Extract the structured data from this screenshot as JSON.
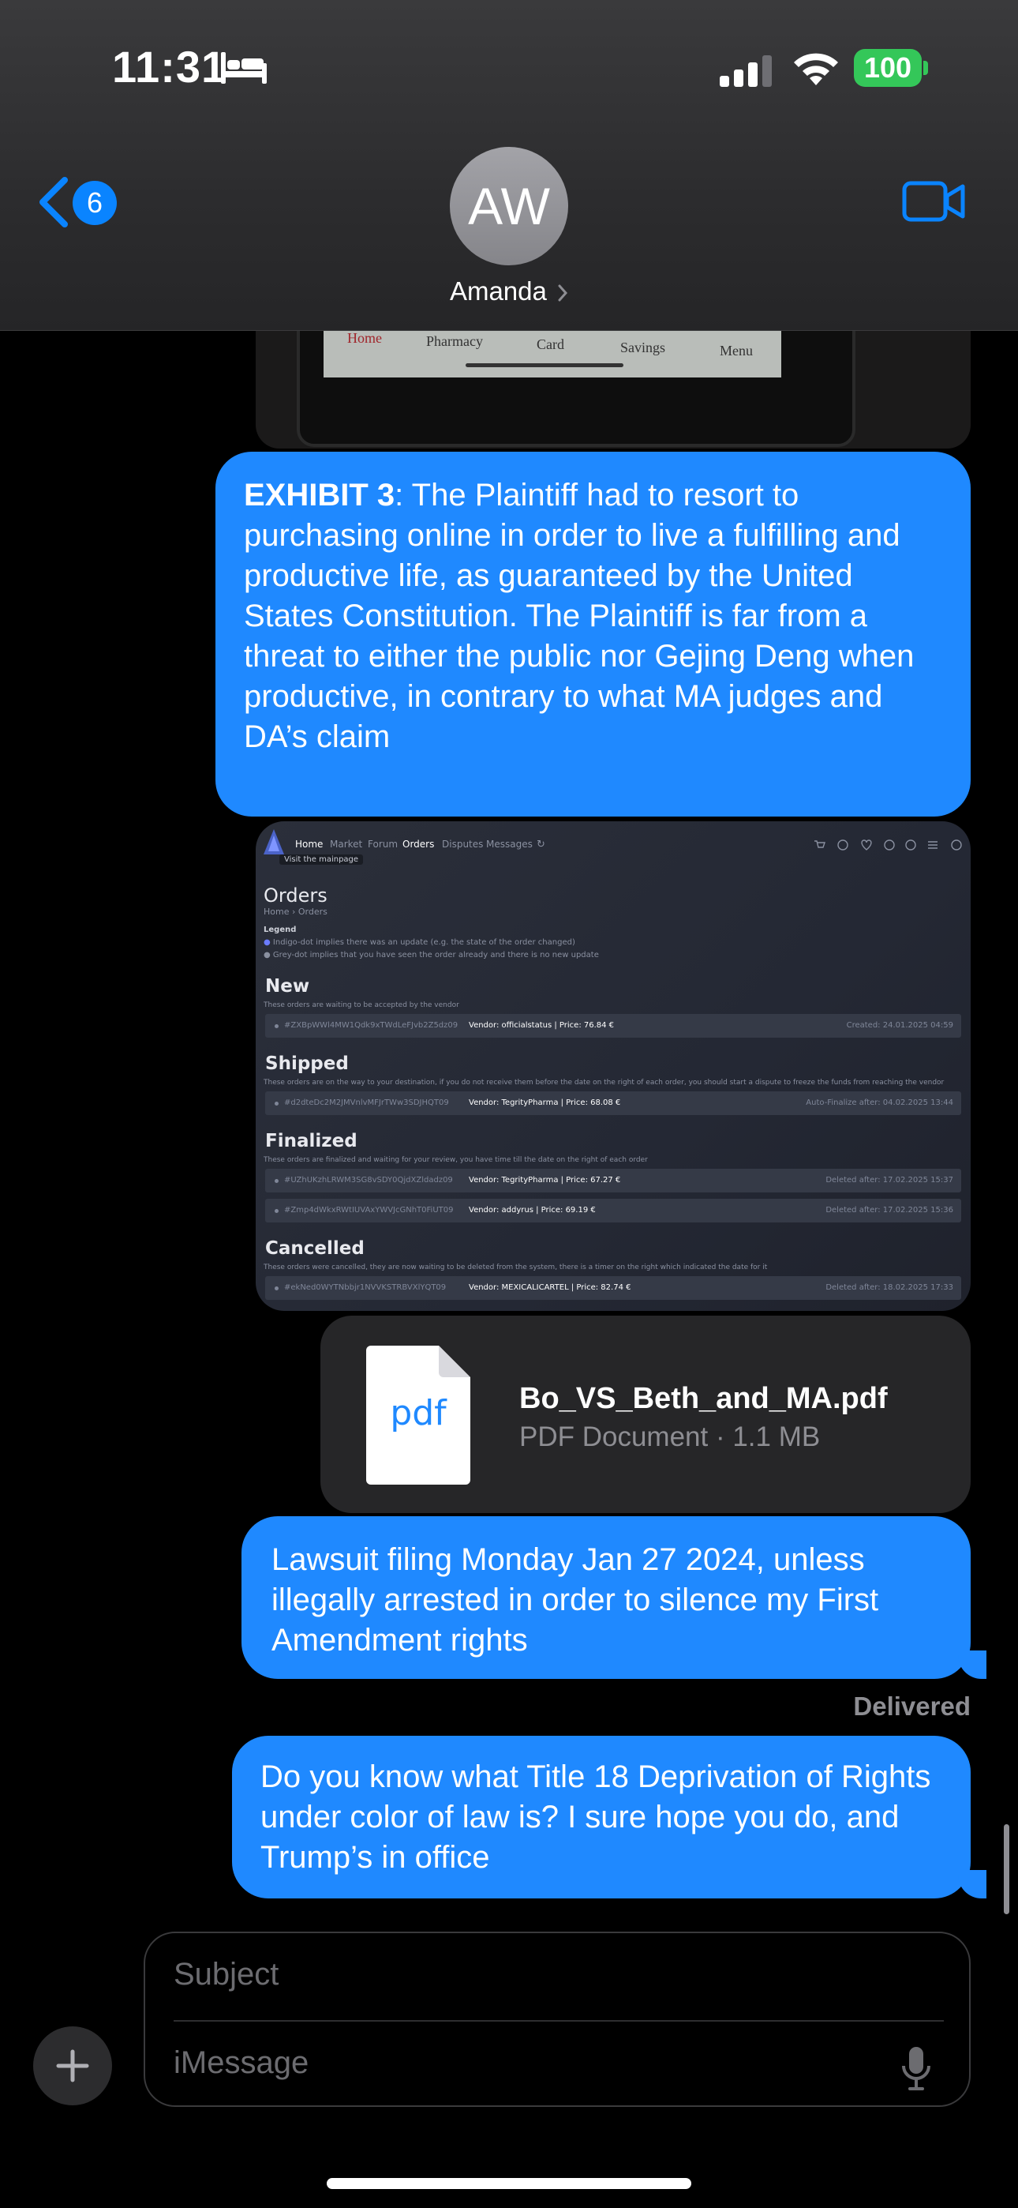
{
  "status_bar": {
    "time": "11:31",
    "battery": "100",
    "icons": [
      "bed-icon",
      "signal-icon",
      "wifi-icon",
      "battery-icon"
    ]
  },
  "header": {
    "back_badge": "6",
    "avatar_initials": "AW",
    "contact_name": "Amanda",
    "icons": [
      "chevron-left-icon",
      "video-call-icon",
      "chevron-right-icon"
    ]
  },
  "photo_preview": {
    "tabs": [
      "Home",
      "Pharmacy",
      "Card",
      "Savings",
      "Menu"
    ]
  },
  "messages": {
    "exhibit": {
      "bold": "EXHIBIT 3",
      "text": ": The Plaintiff had to resort to purchasing online in order to live a fulfilling and productive life, as guaranteed by the United States Constitution. The Plaintiff is far from a threat to either the public nor Gejing Deng when productive, in contrary to what MA judges and DA’s claim"
    },
    "lawsuit": "Lawsuit filing Monday Jan 27 2024, unless illegally arrested in order to silence my First Amendment rights",
    "delivered": "Delivered",
    "title18": "Do you know what Title 18 Deprivation of Rights under color of law is? I sure hope you do, and Trump’s in office"
  },
  "orders_screenshot": {
    "nav": [
      "Home",
      "Market",
      "Forum",
      "Orders",
      "Disputes",
      "Messages"
    ],
    "tooltip": "Visit the mainpage",
    "title": "Orders",
    "breadcrumb": "Home  ›  Orders",
    "legend_title": "Legend",
    "legend_1": "Indigo-dot implies there was an update (e.g. the state of the order changed)",
    "legend_2": "Grey-dot implies that you have seen the order already and there is no new update",
    "sections": [
      {
        "heading": "New",
        "desc": "These orders are waiting to be accepted by the vendor",
        "rows": [
          {
            "id": "#ZXBpWWl4MW1Qdk9xTWdLeFJvb2Z5dz09",
            "vendor": "Vendor: officialstatus | Price: 76.84 €",
            "right": "Created: 24.01.2025 04:59"
          }
        ]
      },
      {
        "heading": "Shipped",
        "desc": "These orders are on the way to your destination, if you do not receive them before the date on the right of each order, you should start a dispute to freeze the funds from reaching the vendor",
        "rows": [
          {
            "id": "#d2dteDc2M2JMVnlvMFJrTWw3SDJHQT09",
            "vendor": "Vendor: TegrityPharma | Price: 68.08 €",
            "right": "Auto-Finalize after: 04.02.2025 13:44"
          }
        ]
      },
      {
        "heading": "Finalized",
        "desc": "These orders are finalized and waiting for your review, you have time till the date on the right of each order",
        "rows": [
          {
            "id": "#UZhUKzhLRWM3SG8vSDY0QjdXZldadz09",
            "vendor": "Vendor: TegrityPharma | Price: 67.27 €",
            "right": "Deleted after: 17.02.2025 15:37"
          },
          {
            "id": "#Zmp4dWkxRWtIUVAxYWVJcGNhT0FiUT09",
            "vendor": "Vendor: addyrus | Price: 69.19 €",
            "right": "Deleted after: 17.02.2025 15:36"
          }
        ]
      },
      {
        "heading": "Cancelled",
        "desc": "These orders were cancelled, they are now waiting to be deleted from the system, there is a timer on the right which indicated the date for it",
        "rows": [
          {
            "id": "#ekNed0WYTNbbjr1NVVKSTRBVXlYQT09",
            "vendor": "Vendor: MEXICALICARTEL | Price: 82.74 €",
            "right": "Deleted after: 18.02.2025 17:33"
          }
        ]
      }
    ]
  },
  "attachment": {
    "icon_label": "pdf",
    "file_name": "Bo_VS_Beth_and_MA.pdf",
    "meta": "PDF Document · 1.1 MB"
  },
  "compose": {
    "subject_placeholder": "Subject",
    "message_placeholder": "iMessage"
  },
  "colors": {
    "bubble_blue": "#1f89ff",
    "accent_blue": "#0a84ff",
    "battery_green": "#34c759"
  }
}
